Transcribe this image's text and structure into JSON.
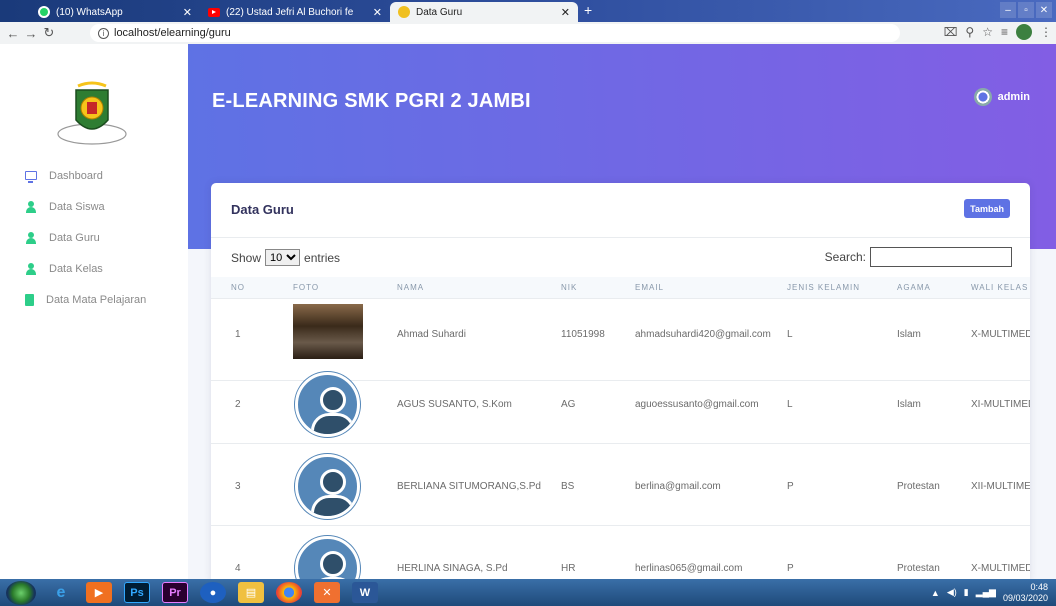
{
  "browser": {
    "tabs": [
      {
        "label": "(10) WhatsApp",
        "icon": "whatsapp-icon"
      },
      {
        "label": "(22) Ustad Jefri Al Buchori fe",
        "icon": "youtube-icon"
      },
      {
        "label": "Data Guru",
        "icon": "site-favicon",
        "active": true
      }
    ],
    "url": "localhost/elearning/guru"
  },
  "sidebar": {
    "items": [
      {
        "label": "Dashboard",
        "icon": "monitor-icon"
      },
      {
        "label": "Data Siswa",
        "icon": "user-icon"
      },
      {
        "label": "Data Guru",
        "icon": "user-icon"
      },
      {
        "label": "Data Kelas",
        "icon": "user-icon"
      },
      {
        "label": "Data Mata Pelajaran",
        "icon": "book-icon"
      }
    ]
  },
  "header": {
    "title": "E-LEARNING SMK PGRI 2 JAMBI",
    "user": "admin"
  },
  "card": {
    "title": "Data Guru",
    "add_button": "Tambah",
    "show_label": "Show",
    "entries_label": "entries",
    "page_length": "10",
    "search_label": "Search:"
  },
  "table": {
    "columns": [
      "NO",
      "FOTO",
      "NAMA",
      "NIK",
      "EMAIL",
      "JENIS KELAMIN",
      "AGAMA",
      "WALI KELAS"
    ],
    "rows": [
      {
        "no": "1",
        "nama": "Ahmad Suhardi",
        "nik": "11051998",
        "email": "ahmadsuhardi420@gmail.com",
        "jk": "L",
        "agama": "Islam",
        "wali": "X-MULTIMEDIA",
        "photo": "portrait"
      },
      {
        "no": "2",
        "nama": "AGUS SUSANTO, S.Kom",
        "nik": "AG",
        "email": "aguoessusanto@gmail.com",
        "jk": "L",
        "agama": "Islam",
        "wali": "XI-MULTIMEDIA",
        "photo": "default-avatar"
      },
      {
        "no": "3",
        "nama": "BERLIANA SITUMORANG,S.Pd",
        "nik": "BS",
        "email": "berlina@gmail.com",
        "jk": "P",
        "agama": "Protestan",
        "wali": "XII-MULTIMEDIA",
        "photo": "default-avatar"
      },
      {
        "no": "4",
        "nama": "HERLINA SINAGA, S.Pd",
        "nik": "HR",
        "email": "herlinas065@gmail.com",
        "jk": "P",
        "agama": "Protestan",
        "wali": "X-MULTIMEDIA",
        "photo": "default-avatar"
      }
    ]
  },
  "taskbar": {
    "time": "0:48",
    "date": "09/03/2020"
  },
  "colors": {
    "primary": "#5e72e4",
    "header_gradient_end": "#825ee4",
    "success": "#2dce89"
  }
}
